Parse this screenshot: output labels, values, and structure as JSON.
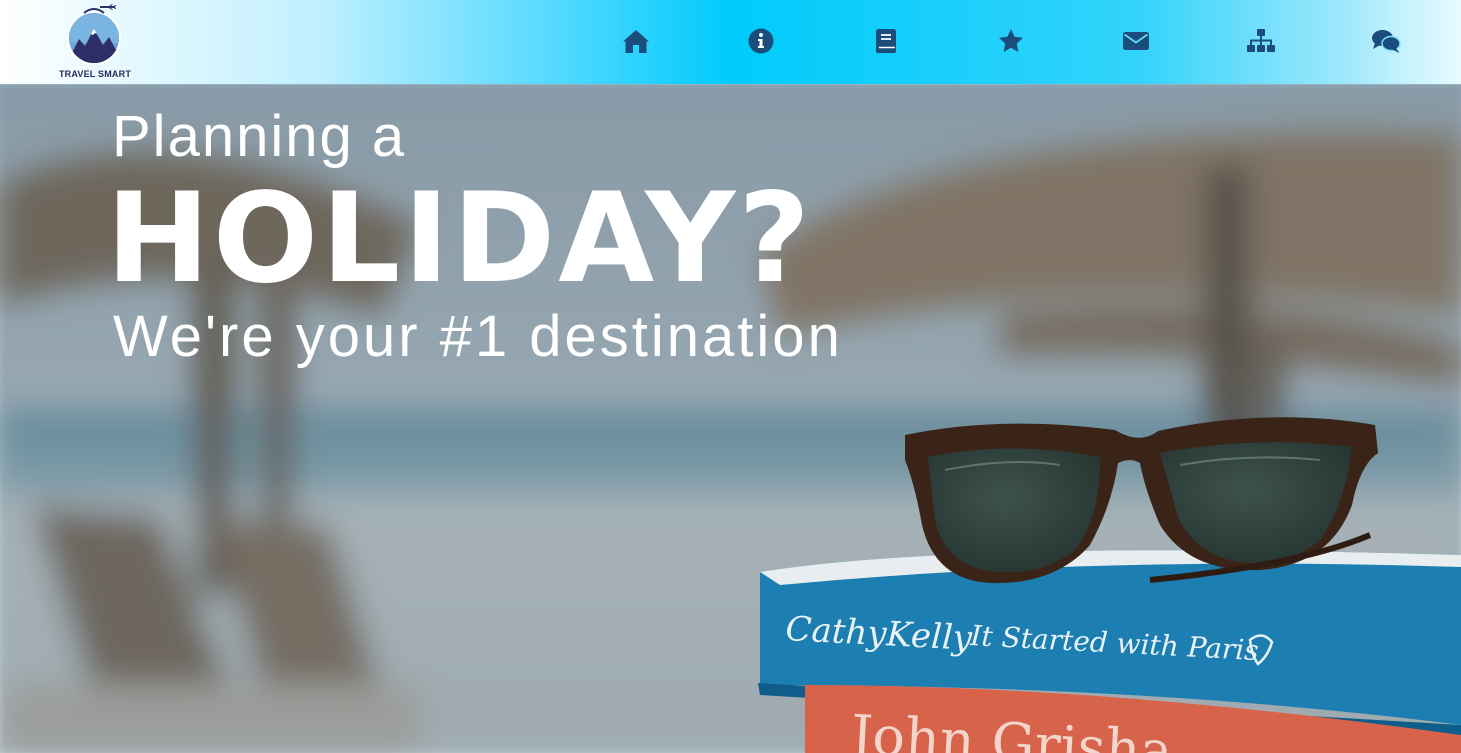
{
  "brand": {
    "name": "TRAVEL SMART"
  },
  "nav": {
    "items": [
      {
        "icon": "home-icon"
      },
      {
        "icon": "info-icon"
      },
      {
        "icon": "book-icon"
      },
      {
        "icon": "star-icon"
      },
      {
        "icon": "envelope-icon"
      },
      {
        "icon": "sitemap-icon"
      },
      {
        "icon": "comments-icon"
      }
    ],
    "icon_color": "#1a4d7c"
  },
  "hero": {
    "line1": "Planning a",
    "line2": "HOLIDAY?",
    "line3": "We're your #1 destination",
    "book1_author": "CathyKelly",
    "book1_title": "It Started with Paris",
    "book2_author": "John Grisha"
  },
  "colors": {
    "accent": "#00c8f8",
    "navy": "#262b5c"
  }
}
